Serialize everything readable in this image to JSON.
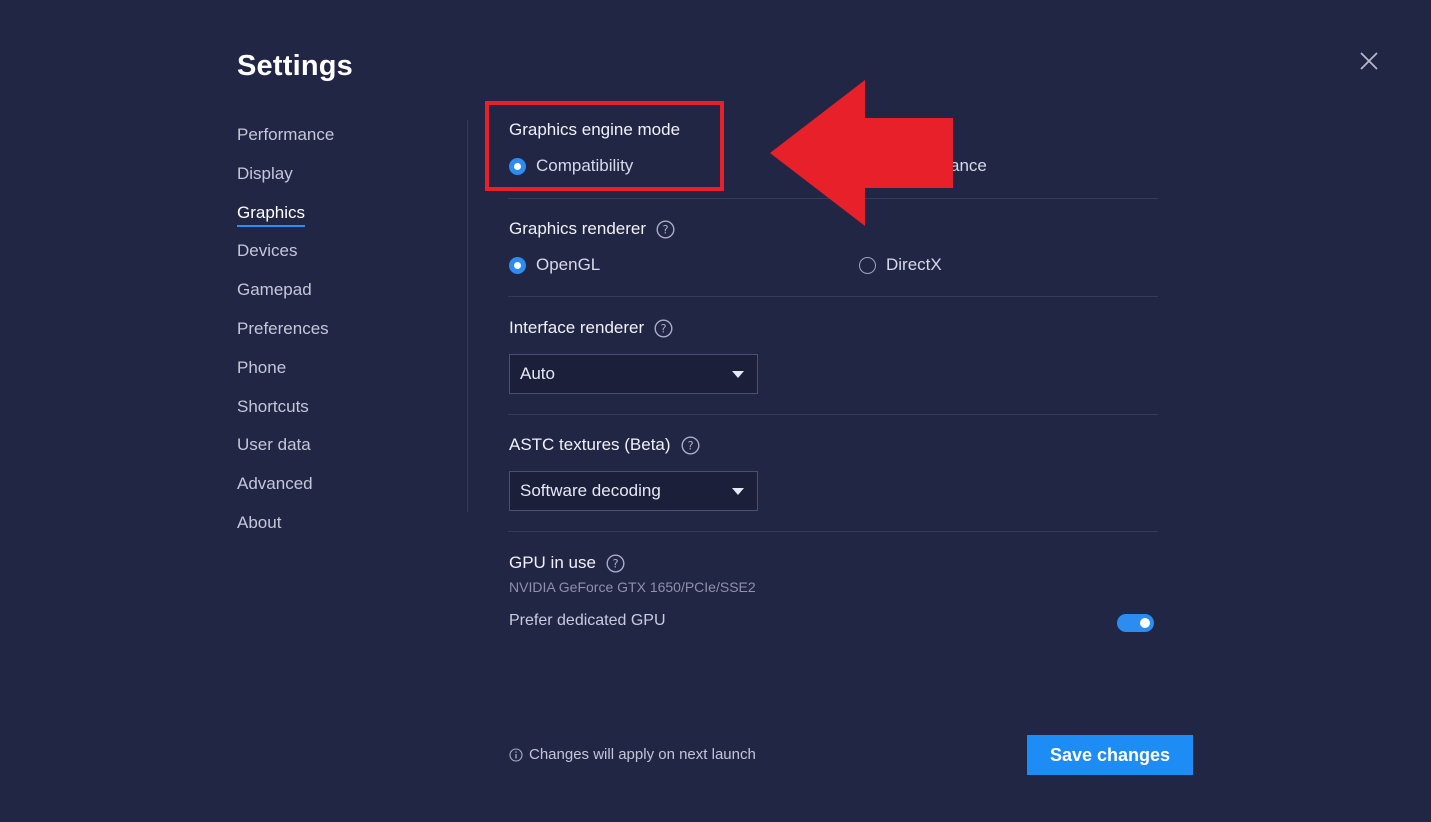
{
  "window": {
    "title": "Settings",
    "close_icon": "close-icon"
  },
  "sidebar": {
    "items": [
      {
        "label": "Performance"
      },
      {
        "label": "Display"
      },
      {
        "label": "Graphics",
        "active": true
      },
      {
        "label": "Devices"
      },
      {
        "label": "Gamepad"
      },
      {
        "label": "Preferences"
      },
      {
        "label": "Phone"
      },
      {
        "label": "Shortcuts"
      },
      {
        "label": "User data"
      },
      {
        "label": "Advanced"
      },
      {
        "label": "About"
      }
    ]
  },
  "graphics": {
    "engine_mode": {
      "label": "Graphics engine mode",
      "options": [
        {
          "label": "Compatibility",
          "selected": true
        },
        {
          "label": "ance",
          "selected": false
        }
      ]
    },
    "renderer": {
      "label": "Graphics renderer",
      "options": [
        {
          "label": "OpenGL",
          "selected": true
        },
        {
          "label": "DirectX",
          "selected": false
        }
      ]
    },
    "interface_renderer": {
      "label": "Interface renderer",
      "value": "Auto"
    },
    "astc": {
      "label": "ASTC textures (Beta)",
      "value": "Software decoding"
    },
    "gpu": {
      "label": "GPU in use",
      "name": "NVIDIA GeForce GTX 1650/PCIe/SSE2",
      "prefer_dedicated_label": "Prefer dedicated GPU",
      "prefer_dedicated_on": true
    }
  },
  "footer": {
    "note": "Changes will apply on next launch",
    "save_label": "Save changes"
  },
  "colors": {
    "background": "#222645",
    "accent": "#2d8cf0",
    "annotation": "#e8202a"
  }
}
